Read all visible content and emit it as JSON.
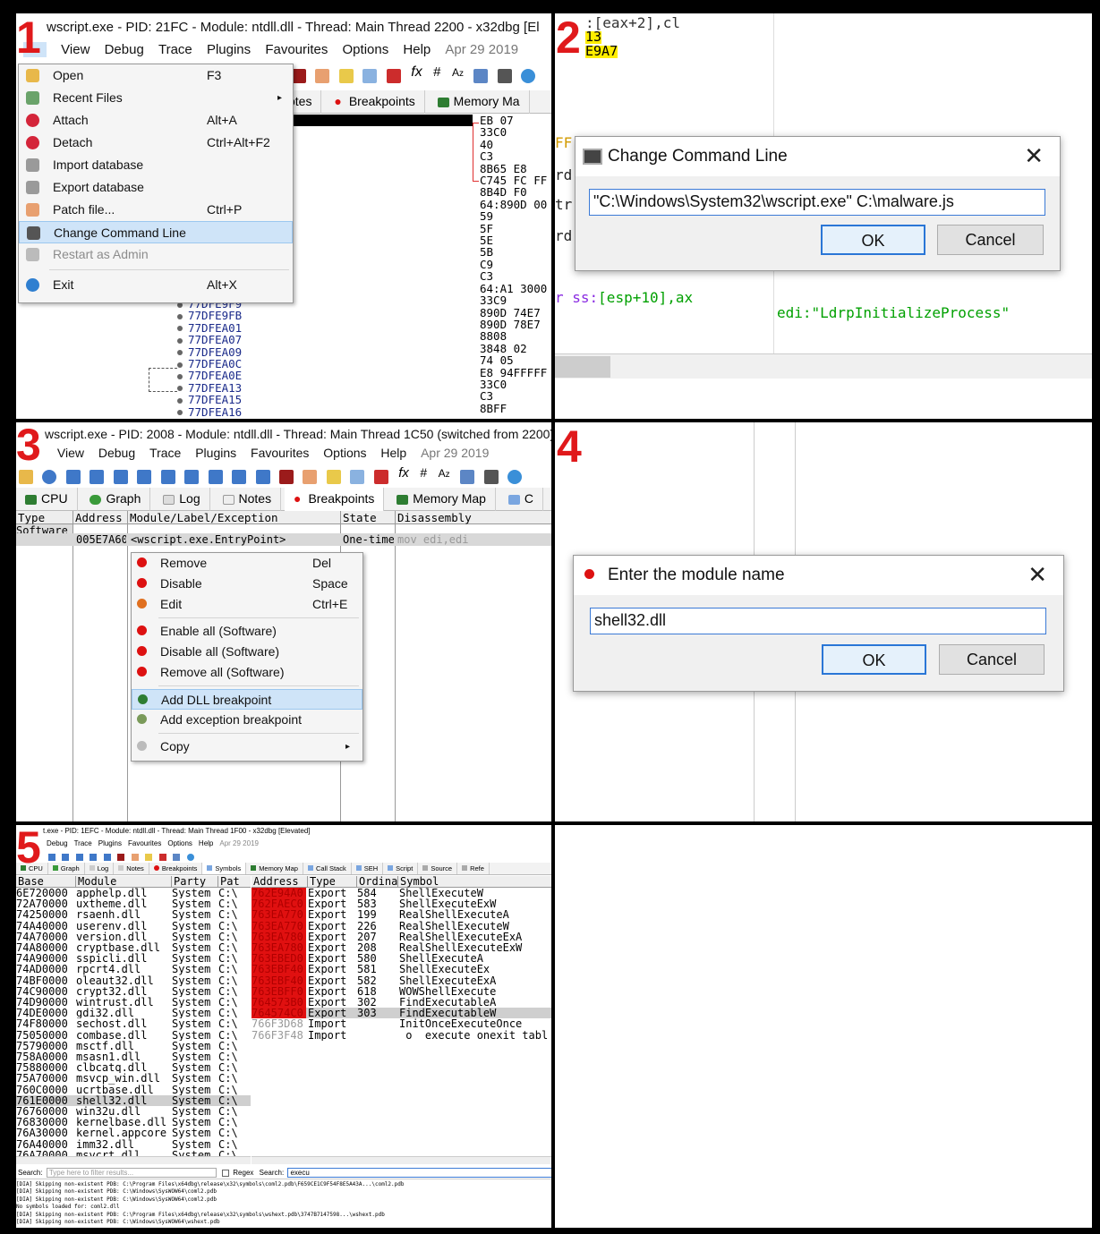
{
  "p1": {
    "number": "1",
    "title": "wscript.exe - PID: 21FC - Module: ntdll.dll - Thread: Main Thread 2200 - x32dbg [El",
    "menu": [
      "File",
      "View",
      "Debug",
      "Trace",
      "Plugins",
      "Favourites",
      "Options",
      "Help"
    ],
    "date": "Apr 29 2019",
    "tabs": [
      "otes",
      "Breakpoints",
      "Memory Ma"
    ],
    "file_menu": [
      {
        "label": "Open",
        "shortcut": "F3",
        "icon": "folder-icon"
      },
      {
        "label": "Recent Files",
        "shortcut": "",
        "icon": "recent-icon",
        "submenu": true
      },
      {
        "label": "Attach",
        "shortcut": "Alt+A",
        "icon": "heart-icon"
      },
      {
        "label": "Detach",
        "shortcut": "Ctrl+Alt+F2",
        "icon": "heart-broken-icon"
      },
      {
        "label": "Import database",
        "shortcut": "",
        "icon": "database-icon"
      },
      {
        "label": "Export database",
        "shortcut": "",
        "icon": "database-icon"
      },
      {
        "label": "Patch file...",
        "shortcut": "Ctrl+P",
        "icon": "patch-icon"
      },
      {
        "label": "Change Command Line",
        "shortcut": "",
        "icon": "console-icon",
        "selected": true
      },
      {
        "label": "Restart as Admin",
        "shortcut": "",
        "icon": "shield-icon",
        "disabled": true
      },
      {
        "label": "Exit",
        "shortcut": "Alt+X",
        "icon": "power-icon"
      }
    ],
    "addresses": [
      "77DFE9F9",
      "77DFE9FB",
      "77DFEA01",
      "77DFEA07",
      "77DFEA09",
      "77DFEA0C",
      "77DFEA0E",
      "77DFEA13",
      "77DFEA15",
      "77DFEA16"
    ],
    "bytes": [
      "EB 07",
      "33C0",
      "40",
      "C3",
      "8B65 E8",
      "C745 FC FF",
      "8B4D F0",
      "64:890D 00",
      "59",
      "5F",
      "5E",
      "5B",
      "C9",
      "C3",
      "64:A1 3000",
      "33C9",
      "890D 74E7",
      "890D 78E7",
      "8808",
      "3848 02",
      "74 05",
      "E8 94FFFFF",
      "33C0",
      "C3",
      "8BFF"
    ]
  },
  "p2": {
    "number": "2",
    "asm_top": ":[eax+2],cl",
    "asm_hl1": "13",
    "asm_hl2": "E9A7",
    "frag_ff": "FF",
    "frag_rd1": "rd",
    "frag_tr": "tr",
    "frag_rd2": "rd",
    "asm_ss_prefix": "r ss:",
    "asm_ss_bracket": "[esp+10]",
    "asm_ss_suffix": ",ax",
    "comment": "edi:\"LdrpInitializeProcess\"",
    "dialog": {
      "title": "Change Command Line",
      "value": "\"C:\\Windows\\System32\\wscript.exe\" C:\\malware.js",
      "ok": "OK",
      "cancel": "Cancel"
    }
  },
  "p3": {
    "number": "3",
    "title": "wscript.exe - PID: 2008 - Module: ntdll.dll - Thread: Main Thread 1C50 (switched from 2200) -",
    "menu": [
      "File",
      "View",
      "Debug",
      "Trace",
      "Plugins",
      "Favourites",
      "Options",
      "Help"
    ],
    "date": "Apr 29 2019",
    "tabs": [
      "CPU",
      "Graph",
      "Log",
      "Notes",
      "Breakpoints",
      "Memory Map",
      "C"
    ],
    "columns": [
      "Type",
      "Address",
      "Module/Label/Exception",
      "State",
      "Disassembly"
    ],
    "section": "Software",
    "bp_row": {
      "address": "005E7A60",
      "label": "<wscript.exe.EntryPoint>",
      "state": "One-time",
      "disasm": "mov edi,edi"
    },
    "context_menu": [
      {
        "label": "Remove",
        "shortcut": "Del"
      },
      {
        "label": "Disable",
        "shortcut": "Space"
      },
      {
        "label": "Edit",
        "shortcut": "Ctrl+E"
      },
      {
        "label": "Enable all (Software)",
        "shortcut": ""
      },
      {
        "label": "Disable all (Software)",
        "shortcut": ""
      },
      {
        "label": "Remove all (Software)",
        "shortcut": ""
      },
      {
        "label": "Add DLL breakpoint",
        "shortcut": "",
        "selected": true
      },
      {
        "label": "Add exception breakpoint",
        "shortcut": ""
      },
      {
        "label": "Copy",
        "shortcut": "",
        "submenu": true
      }
    ]
  },
  "p4": {
    "number": "4",
    "dialog": {
      "title": "Enter the module name",
      "value": "shell32.dll",
      "ok": "OK",
      "cancel": "Cancel"
    }
  },
  "p5": {
    "number": "5",
    "title": "t.exe - PID: 1EFC - Module: ntdll.dll - Thread: Main Thread 1F00 - x32dbg [Elevated]",
    "menu": [
      "Debug",
      "Trace",
      "Plugins",
      "Favourites",
      "Options",
      "Help",
      "Apr 29 2019"
    ],
    "tabs": [
      "CPU",
      "Graph",
      "Log",
      "Notes",
      "Breakpoints",
      "Symbols",
      "Memory Map",
      "Call Stack",
      "SEH",
      "Script",
      "Source",
      "Refe"
    ],
    "mod_cols": [
      "Base",
      "Module",
      "Party",
      "Pat"
    ],
    "sym_cols": [
      "Address",
      "Type",
      "Ordina",
      "Symbol"
    ],
    "modules": [
      [
        "6E720000",
        "apphelp.dll",
        "System",
        "C:\\"
      ],
      [
        "72A70000",
        "uxtheme.dll",
        "System",
        "C:\\"
      ],
      [
        "74250000",
        "rsaenh.dll",
        "System",
        "C:\\"
      ],
      [
        "74A40000",
        "userenv.dll",
        "System",
        "C:\\"
      ],
      [
        "74A70000",
        "version.dll",
        "System",
        "C:\\"
      ],
      [
        "74A80000",
        "cryptbase.dll",
        "System",
        "C:\\"
      ],
      [
        "74A90000",
        "sspicli.dll",
        "System",
        "C:\\"
      ],
      [
        "74AD0000",
        "rpcrt4.dll",
        "System",
        "C:\\"
      ],
      [
        "74BF0000",
        "oleaut32.dll",
        "System",
        "C:\\"
      ],
      [
        "74C90000",
        "crypt32.dll",
        "System",
        "C:\\"
      ],
      [
        "74D90000",
        "wintrust.dll",
        "System",
        "C:\\"
      ],
      [
        "74DE0000",
        "gdi32.dll",
        "System",
        "C:\\"
      ],
      [
        "74F80000",
        "sechost.dll",
        "System",
        "C:\\"
      ],
      [
        "75050000",
        "combase.dll",
        "System",
        "C:\\"
      ],
      [
        "75790000",
        "msctf.dll",
        "System",
        "C:\\"
      ],
      [
        "758A0000",
        "msasn1.dll",
        "System",
        "C:\\"
      ],
      [
        "75880000",
        "clbcatq.dll",
        "System",
        "C:\\"
      ],
      [
        "75A70000",
        "msvcp_win.dll",
        "System",
        "C:\\"
      ],
      [
        "760C0000",
        "ucrtbase.dll",
        "System",
        "C:\\"
      ],
      [
        "761E0000",
        "shell32.dll",
        "System",
        "C:\\"
      ],
      [
        "76760000",
        "win32u.dll",
        "System",
        "C:\\"
      ],
      [
        "76830000",
        "kernelbase.dll",
        "System",
        "C:\\"
      ],
      [
        "76A30000",
        "kernel.appcore",
        "System",
        "C:\\"
      ],
      [
        "76A40000",
        "imm32.dll",
        "System",
        "C:\\"
      ],
      [
        "76A70000",
        "msvcrt.dll",
        "System",
        "C:\\"
      ]
    ],
    "symbols": [
      [
        "762E94A0",
        "Export",
        "584",
        "ShellExecuteW"
      ],
      [
        "762FAEC0",
        "Export",
        "583",
        "ShellExecuteExW"
      ],
      [
        "763EA770",
        "Export",
        "199",
        "RealShellExecuteA"
      ],
      [
        "763EA770",
        "Export",
        "226",
        "RealShellExecuteW"
      ],
      [
        "763EA780",
        "Export",
        "207",
        "RealShellExecuteExA"
      ],
      [
        "763EA780",
        "Export",
        "208",
        "RealShellExecuteExW"
      ],
      [
        "763EBED0",
        "Export",
        "580",
        "ShellExecuteA"
      ],
      [
        "763EBF40",
        "Export",
        "581",
        "ShellExecuteEx"
      ],
      [
        "763EBF40",
        "Export",
        "582",
        "ShellExecuteExA"
      ],
      [
        "763EBFF0",
        "Export",
        "618",
        "WOWShellExecute"
      ],
      [
        "764573B0",
        "Export",
        "302",
        "FindExecutableA"
      ],
      [
        "764574C0",
        "Export",
        "303",
        "FindExecutableW"
      ],
      [
        "766F3D68",
        "Import",
        "",
        "InitOnceExecuteOnce"
      ],
      [
        "766F3F48",
        "Import",
        "",
        "_o__execute_onexit_tabl"
      ]
    ],
    "search_label": "Search:",
    "search_placeholder": "Type here to filter results...",
    "regex_label": "Regex",
    "search2_label": "Search:",
    "search_value": "execu",
    "log": [
      "[DIA] Skipping non-existent PDB: C:\\Program Files\\x64dbg\\release\\x32\\symbols\\coml2.pdb\\F659CE1C9F54F8E5A43A...\\coml2.pdb",
      "[DIA] Skipping non-existent PDB: C:\\Windows\\SysWOW64\\coml2.pdb",
      "[DIA] Skipping non-existent PDB: C:\\Windows\\SysWOW64\\coml2.pdb",
      "No symbols loaded for: coml2.dll",
      "[DIA] Skipping non-existent PDB: C:\\Program Files\\x64dbg\\release\\x32\\symbols\\wshext.pdb\\3747B7147598...\\wshext.pdb",
      "[DIA] Skipping non-existent PDB: C:\\Windows\\SysWOW64\\wshext.pdb"
    ]
  }
}
